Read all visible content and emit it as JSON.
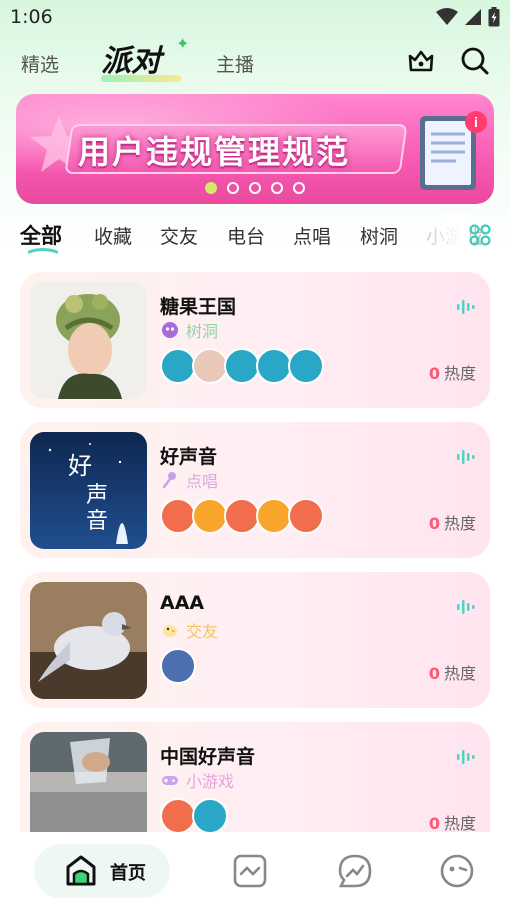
{
  "status": {
    "time": "1:06"
  },
  "top_tabs": {
    "featured": "精选",
    "party": "派对",
    "host": "主播"
  },
  "banner": {
    "title": "用户违规管理规范",
    "badge": "i",
    "slides": 5,
    "active_slide": 0
  },
  "categories": [
    "全部",
    "收藏",
    "交友",
    "电台",
    "点唱",
    "树洞",
    "小游戏"
  ],
  "active_category": "全部",
  "rooms": [
    {
      "title": "糖果王国",
      "tag": "树洞",
      "tag_color": "#8fd7a6",
      "avatars": 5,
      "heat": "0",
      "heat_label": "热度"
    },
    {
      "title": "好声音",
      "tag": "点唱",
      "tag_color": "#d9a9e8",
      "avatars": 5,
      "heat": "0",
      "heat_label": "热度",
      "poster_text": "好声音"
    },
    {
      "title": "AAA",
      "tag": "交友",
      "tag_color": "#f8c35b",
      "avatars": 1,
      "heat": "0",
      "heat_label": "热度"
    },
    {
      "title": "中国好声音",
      "tag": "小游戏",
      "tag_color": "#e9a3dd",
      "avatars": 2,
      "heat": "0",
      "heat_label": "热度"
    }
  ],
  "bottom_nav": {
    "home": "首页"
  },
  "colors": {
    "accent_green": "#3ec46d",
    "heat_red": "#ff5773",
    "wave_teal": "#4fd3c4"
  }
}
